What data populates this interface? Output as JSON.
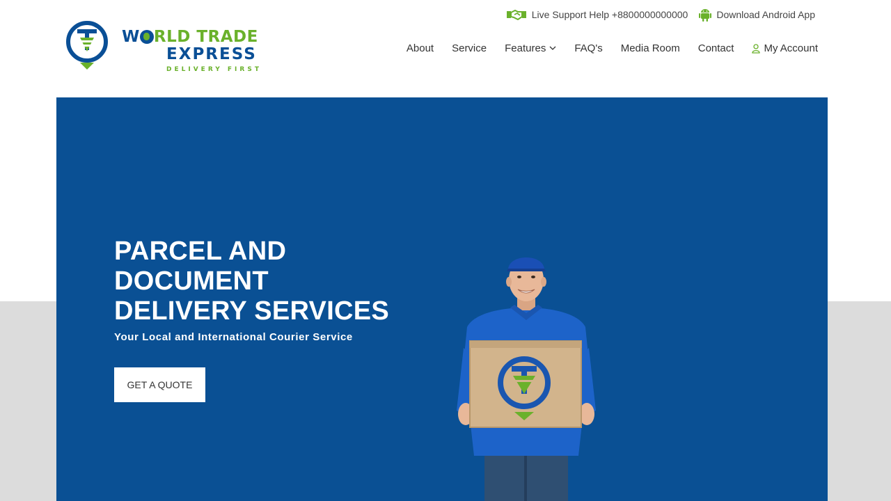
{
  "brand": {
    "title_part1": "W",
    "title_part2": "RLD TRADE",
    "title_line2_part1": "E",
    "title_line2_part2": "XPRESS",
    "tagline": "DELIVERY FIRST",
    "colors": {
      "primary": "#0a4f96",
      "accent": "#6ab12b"
    }
  },
  "topbar": {
    "support": {
      "icon": "handshake-icon",
      "label": "Live Support Help +8800000000000"
    },
    "android": {
      "icon": "android-icon",
      "label": "Download Android App"
    }
  },
  "nav": {
    "items": [
      {
        "label": "About"
      },
      {
        "label": "Service"
      },
      {
        "label": "Features",
        "icon": "chevron-down-icon"
      },
      {
        "label": "FAQ's"
      },
      {
        "label": "Media Room"
      },
      {
        "label": "Contact"
      },
      {
        "label": "My Account",
        "icon": "user-icon"
      }
    ]
  },
  "hero": {
    "title_lines": [
      "PARCEL AND",
      "DOCUMENT",
      "DELIVERY SERVICES"
    ],
    "subtitle": "Your Local and International Courier Service",
    "cta_label": "GET A QUOTE",
    "image": "courier-holding-box",
    "background_color": "#0a5094"
  }
}
